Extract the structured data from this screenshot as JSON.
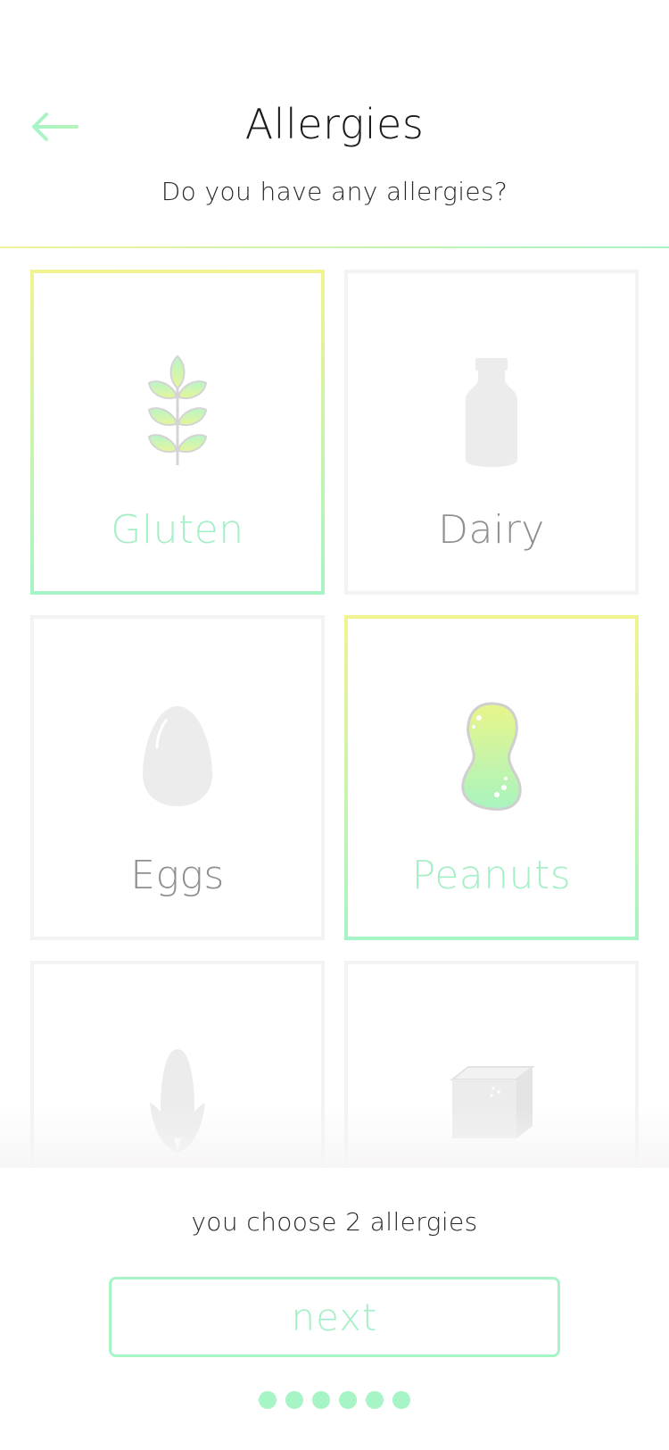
{
  "header": {
    "title": "Allergies",
    "subtitle": "Do you have any allergies?",
    "back_icon": "arrow-left-icon"
  },
  "colors": {
    "accent_green": "#a7f4c6",
    "accent_yellow": "#f1f38f",
    "unselected_border": "#f3f3f3",
    "unselected_label": "#8f8f8f",
    "icon_grey": "#ececec"
  },
  "items": [
    {
      "label": "Gluten",
      "icon": "wheat-icon",
      "selected": true
    },
    {
      "label": "Dairy",
      "icon": "bottle-icon",
      "selected": false
    },
    {
      "label": "Eggs",
      "icon": "egg-icon",
      "selected": false
    },
    {
      "label": "Peanuts",
      "icon": "peanut-icon",
      "selected": true
    },
    {
      "label": "",
      "icon": "corn-icon",
      "selected": false
    },
    {
      "label": "",
      "icon": "sugar-cube-icon",
      "selected": false
    }
  ],
  "footer": {
    "count_text": "you choose 2 allergies",
    "next_label": "next",
    "progress_dots": 6
  }
}
